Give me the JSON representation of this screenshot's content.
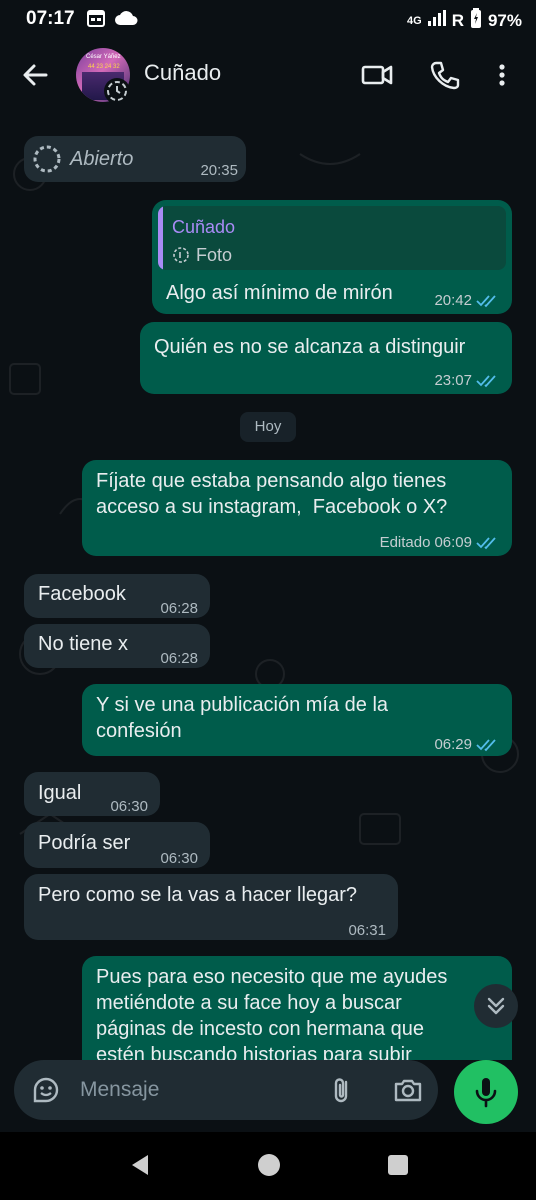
{
  "status_bar": {
    "time": "07:17",
    "network": "4G",
    "roaming": "R",
    "battery": "97%"
  },
  "header": {
    "contact_name": "Cuñado",
    "avatar_text_line1": "César Yáñez",
    "avatar_text_line2": "44 23 24 32"
  },
  "messages": [
    {
      "id": "m1",
      "dir": "in",
      "text": "Abierto",
      "time": "20:35"
    },
    {
      "id": "m2",
      "dir": "out",
      "quote_name": "Cuñado",
      "quote_text": "Foto",
      "text": "Algo así mínimo de mirón",
      "time": "20:42"
    },
    {
      "id": "m3",
      "dir": "out",
      "text": "Quién es no se alcanza a distinguir",
      "time": "23:07"
    },
    {
      "id": "m4",
      "dir": "out",
      "text_line1": "Fíjate que estaba pensando algo tienes",
      "text_line2": "acceso a su instagram,  Facebook o X?",
      "edited": "Editado",
      "time": "06:09"
    },
    {
      "id": "m5",
      "dir": "in",
      "text": "Facebook",
      "time": "06:28"
    },
    {
      "id": "m6",
      "dir": "in",
      "text": "No tiene x",
      "time": "06:28"
    },
    {
      "id": "m7",
      "dir": "out",
      "text_line1": "Y si ve una publicación mía de la",
      "text_line2": "confesión",
      "time": "06:29"
    },
    {
      "id": "m8",
      "dir": "in",
      "text": "Igual",
      "time": "06:30"
    },
    {
      "id": "m9",
      "dir": "in",
      "text": "Podría ser",
      "time": "06:30"
    },
    {
      "id": "m10",
      "dir": "in",
      "text": "Pero como se la vas a hacer llegar?",
      "time": "06:31"
    },
    {
      "id": "m11",
      "dir": "out",
      "text_line1": "Pues para eso necesito que me ayudes",
      "text_line2": "metiéndote a su face hoy a buscar",
      "text_line3": "páginas de incesto con hermana que",
      "text_line4": "estén buscando historias para subir"
    }
  ],
  "day_separator": "Hoy",
  "input": {
    "placeholder": "Mensaje"
  },
  "colors": {
    "outgoing_bubble": "#005c4b",
    "incoming_bubble": "#202c33",
    "background": "#0b1014",
    "mic_button": "#21c063",
    "ticks_read": "#53bdeb"
  }
}
